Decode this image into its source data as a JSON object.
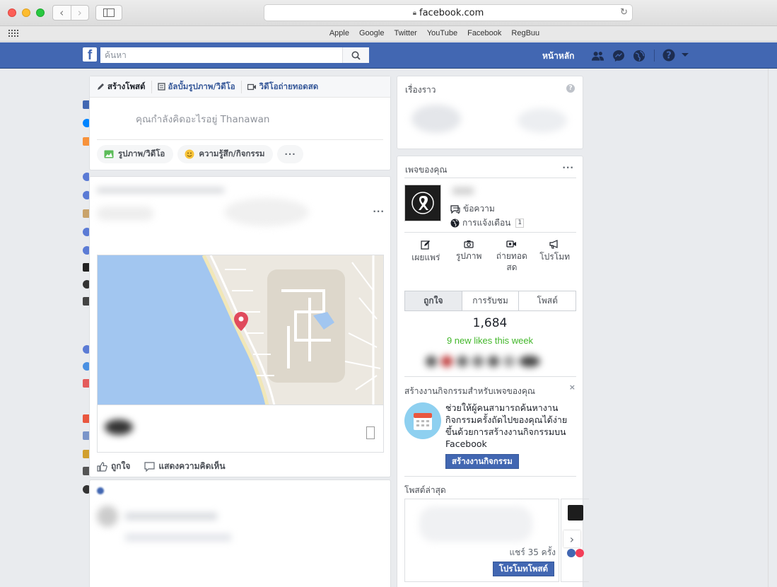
{
  "browser": {
    "url": "facebook.com",
    "favorites": [
      "Apple",
      "Google",
      "Twitter",
      "YouTube",
      "Facebook",
      "RegBuu"
    ]
  },
  "fb_header": {
    "logo": "f",
    "search_placeholder": "ค้นหา",
    "home": "หน้าหลัก",
    "brand_color": "#4267b2"
  },
  "composer": {
    "tabs": [
      "สร้างโพสต์",
      "อัลบั้มรูปภาพ/วิดีโอ",
      "วิดีโอถ่ายทอดสด"
    ],
    "prompt": "คุณกำลังคิดอะไรอยู่ Thanawan",
    "actions": [
      "รูปภาพ/วิดีโอ",
      "ความรู้สึก/กิจกรรม",
      "···"
    ]
  },
  "post": {
    "like": "ถูกใจ",
    "comment": "แสดงความคิดเห็น"
  },
  "story": {
    "title": "เรื่องราว"
  },
  "your_pages": {
    "title": "เพจของคุณ",
    "more": "···",
    "messages": "ข้อความ",
    "notifications": "การแจ้งเตือน",
    "notification_count": "1",
    "tools": [
      "เผยแพร่",
      "รูปภาพ",
      "ถ่ายทอดสด",
      "โปรโมท"
    ],
    "tabs": [
      "ถูกใจ",
      "การรับชม",
      "โพสต์"
    ],
    "likes": "1,684",
    "new_likes": "9 new likes this week",
    "accent_green": "#42b72a"
  },
  "event_promo": {
    "title": "สร้างงานกิจกรรมสำหรับเพจของคุณ",
    "close": "×",
    "text": "ช่วยให้ผู้คนสามารถค้นหางานกิจกรรมครั้งถัดไปของคุณได้ง่ายขึ้นด้วยการสร้างงานกิจกรรมบน Facebook",
    "button": "สร้างงานกิจกรรม"
  },
  "latest_posts": {
    "title": "โพสต์ล่าสุด",
    "shares": "แชร์ 35 ครั้ง",
    "promote": "โปรโมทโพสต์"
  }
}
